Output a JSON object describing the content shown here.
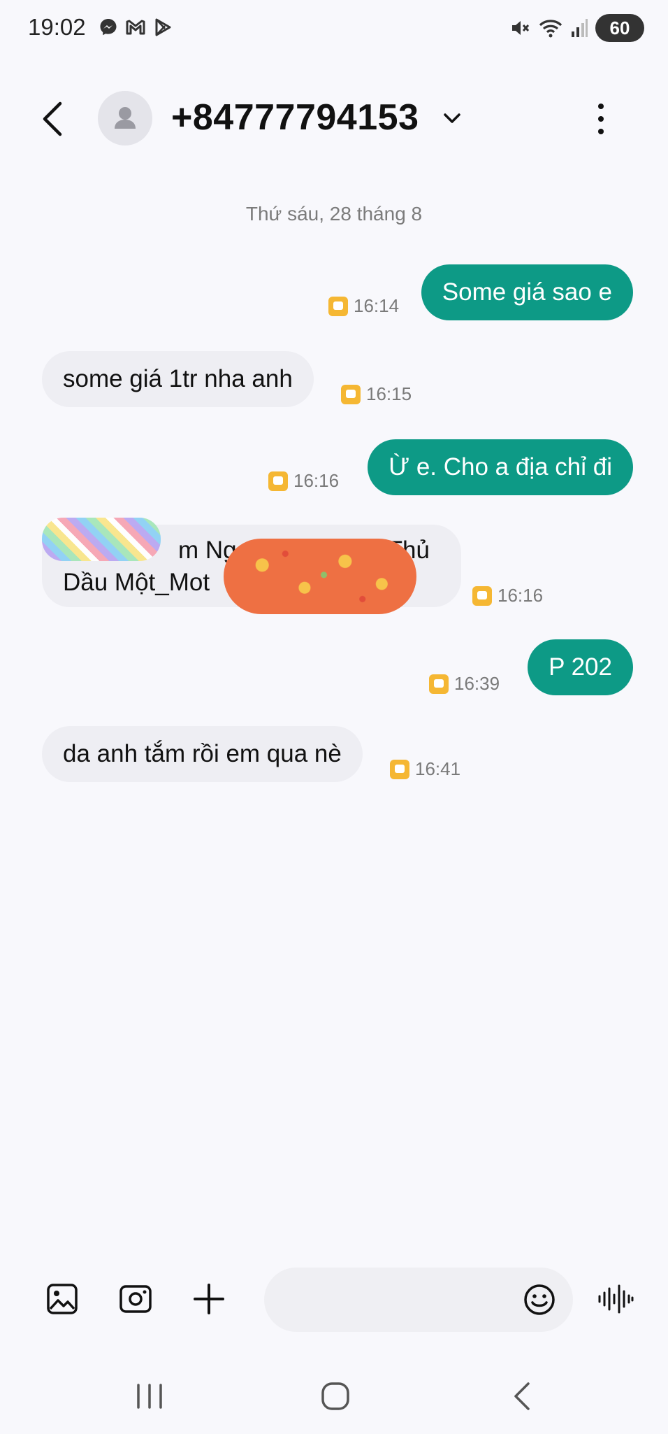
{
  "status_bar": {
    "time": "19:02",
    "battery": "60",
    "left_icons": [
      "messenger-icon",
      "gmail-icon",
      "play-store-icon"
    ],
    "right_icons": [
      "mute-icon",
      "wifi-icon",
      "signal-icon"
    ]
  },
  "header": {
    "contact_number": "+84777794153",
    "icons": [
      "back-icon",
      "avatar-icon",
      "chevron-down-icon",
      "more-vert-icon"
    ]
  },
  "conversation": {
    "date_label": "Thứ sáu, 28 tháng 8",
    "messages": [
      {
        "direction": "outgoing",
        "text": "Some giá sao e",
        "time": "16:14"
      },
      {
        "direction": "incoming",
        "text": "some giá 1tr nha anh",
        "time": "16:15"
      },
      {
        "direction": "outgoing",
        "text": "Ừ e. Cho a địa chỉ đi",
        "time": "16:16"
      },
      {
        "direction": "incoming",
        "text_line1": "m Ngọc Thạch_TP Thủ",
        "text_line2": "Dầu Một_Mot",
        "time": "16:16"
      },
      {
        "direction": "outgoing",
        "text": "P 202",
        "time": "16:39"
      },
      {
        "direction": "incoming",
        "text": "da anh tắm rồi em qua nè",
        "time": "16:41"
      }
    ]
  },
  "composer": {
    "placeholder": "",
    "icons": [
      "gallery-icon",
      "camera-icon",
      "plus-icon",
      "emoji-icon",
      "voice-icon"
    ]
  },
  "colors": {
    "outgoing_bubble": "#0d9a86",
    "incoming_bubble": "#eeeef3",
    "sim_badge": "#f5b733",
    "background": "#f8f8fc"
  }
}
